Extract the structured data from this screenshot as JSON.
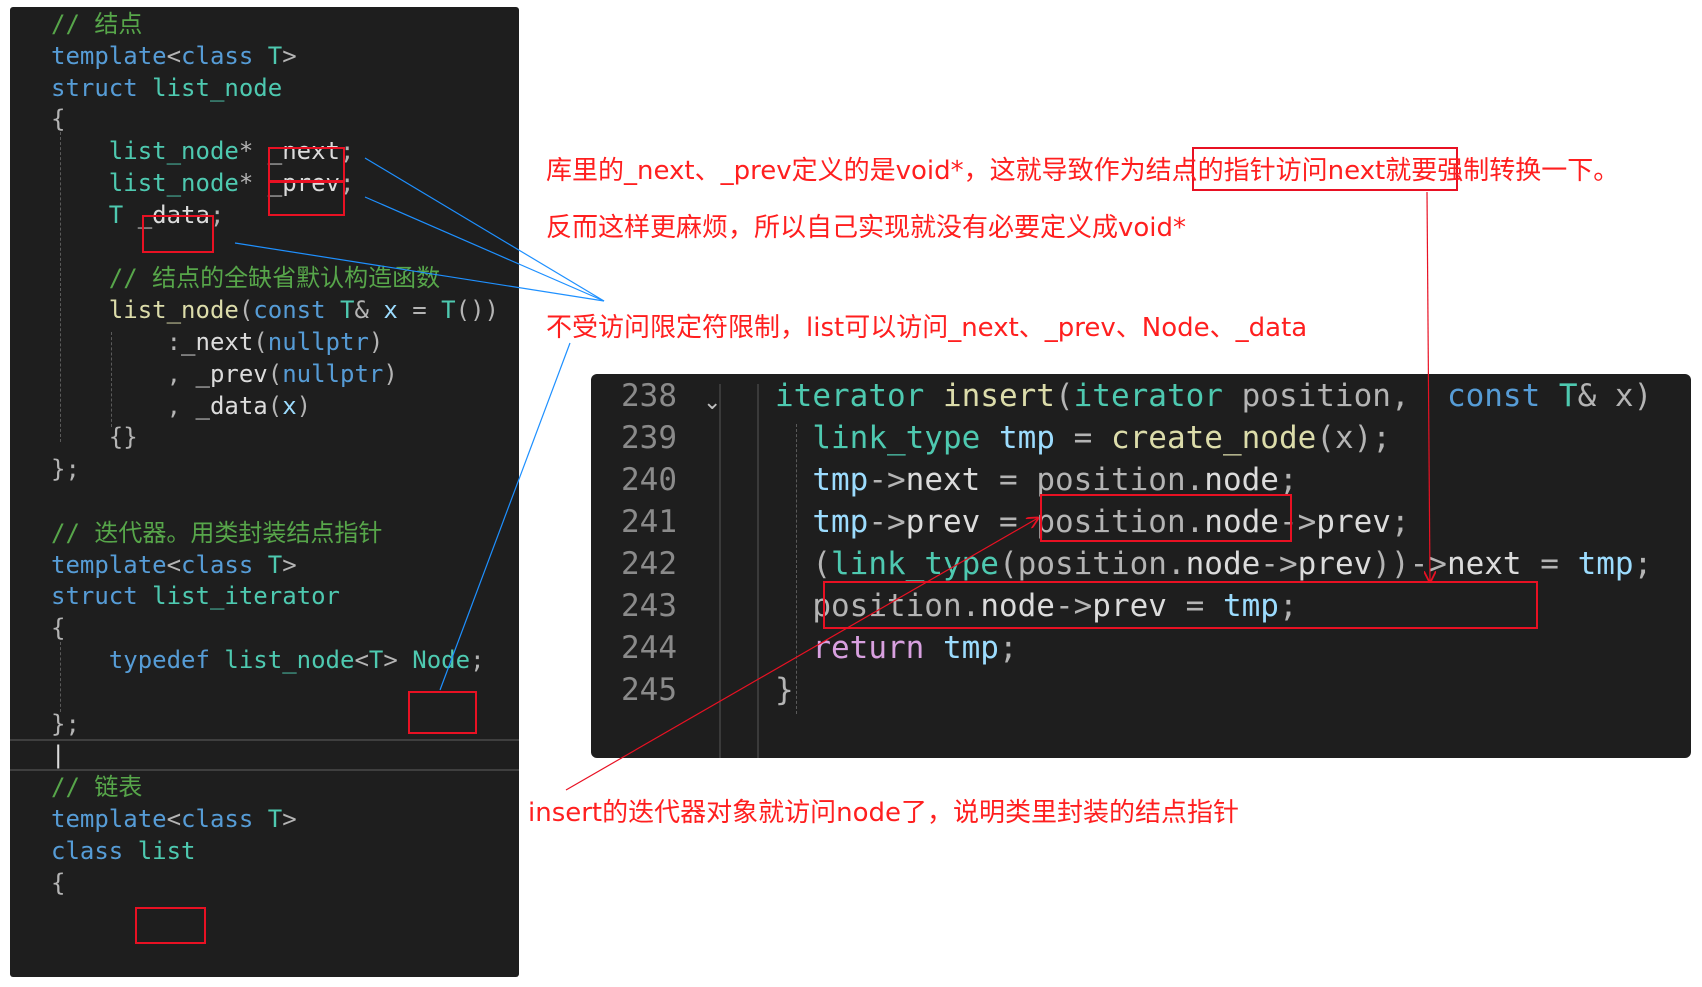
{
  "left_editor": {
    "lines": [
      [
        {
          "t": "// 结点",
          "c": "cm"
        }
      ],
      [
        {
          "t": "template",
          "c": "kw"
        },
        {
          "t": "<",
          "c": "pu"
        },
        {
          "t": "class",
          "c": "kw"
        },
        {
          "t": " T",
          "c": "ty"
        },
        {
          "t": ">",
          "c": "pu"
        }
      ],
      [
        {
          "t": "struct",
          "c": "kw"
        },
        {
          "t": " list_node",
          "c": "ty"
        }
      ],
      [
        {
          "t": "{",
          "c": "pu"
        }
      ],
      [
        {
          "t": "    list_node",
          "c": "ty"
        },
        {
          "t": "* ",
          "c": "pu"
        },
        {
          "t": "_next",
          "c": "id"
        },
        {
          "t": ";",
          "c": "pu"
        }
      ],
      [
        {
          "t": "    list_node",
          "c": "ty"
        },
        {
          "t": "* ",
          "c": "pu"
        },
        {
          "t": "_prev",
          "c": "id"
        },
        {
          "t": ";",
          "c": "pu"
        }
      ],
      [
        {
          "t": "    T",
          "c": "ty"
        },
        {
          "t": " ",
          "c": "pu"
        },
        {
          "t": "_data",
          "c": "id"
        },
        {
          "t": ";",
          "c": "pu"
        }
      ],
      [],
      [
        {
          "t": "    // 结点的全缺省默认构造函数",
          "c": "cm"
        }
      ],
      [
        {
          "t": "    list_node",
          "c": "fn"
        },
        {
          "t": "(",
          "c": "pu"
        },
        {
          "t": "const",
          "c": "kw"
        },
        {
          "t": " T",
          "c": "ty"
        },
        {
          "t": "& ",
          "c": "pu"
        },
        {
          "t": "x",
          "c": "pa"
        },
        {
          "t": " = ",
          "c": "pu"
        },
        {
          "t": "T",
          "c": "ty"
        },
        {
          "t": "())",
          "c": "pu"
        }
      ],
      [
        {
          "t": "        :",
          "c": "pu"
        },
        {
          "t": "_next",
          "c": "id"
        },
        {
          "t": "(",
          "c": "pu"
        },
        {
          "t": "nullptr",
          "c": "kw"
        },
        {
          "t": ")",
          "c": "pu"
        }
      ],
      [
        {
          "t": "        , ",
          "c": "pu"
        },
        {
          "t": "_prev",
          "c": "id"
        },
        {
          "t": "(",
          "c": "pu"
        },
        {
          "t": "nullptr",
          "c": "kw"
        },
        {
          "t": ")",
          "c": "pu"
        }
      ],
      [
        {
          "t": "        , ",
          "c": "pu"
        },
        {
          "t": "_data",
          "c": "id"
        },
        {
          "t": "(",
          "c": "pu"
        },
        {
          "t": "x",
          "c": "pa"
        },
        {
          "t": ")",
          "c": "pu"
        }
      ],
      [
        {
          "t": "    {}",
          "c": "pu"
        }
      ],
      [
        {
          "t": "};",
          "c": "pu"
        }
      ],
      [],
      [
        {
          "t": "// 迭代器。用类封装结点指针",
          "c": "cm"
        }
      ],
      [
        {
          "t": "template",
          "c": "kw"
        },
        {
          "t": "<",
          "c": "pu"
        },
        {
          "t": "class",
          "c": "kw"
        },
        {
          "t": " T",
          "c": "ty"
        },
        {
          "t": ">",
          "c": "pu"
        }
      ],
      [
        {
          "t": "struct",
          "c": "kw"
        },
        {
          "t": " list_iterator",
          "c": "ty"
        }
      ],
      [
        {
          "t": "{",
          "c": "pu"
        }
      ],
      [
        {
          "t": "    typedef",
          "c": "kw"
        },
        {
          "t": " list_node",
          "c": "ty"
        },
        {
          "t": "<",
          "c": "pu"
        },
        {
          "t": "T",
          "c": "ty"
        },
        {
          "t": "> ",
          "c": "pu"
        },
        {
          "t": "Node",
          "c": "ty"
        },
        {
          "t": ";",
          "c": "pu"
        }
      ],
      [],
      [
        {
          "t": "};",
          "c": "pu"
        }
      ],
      [
        {
          "t": "|",
          "c": "id"
        }
      ],
      [
        {
          "t": "// 链表",
          "c": "cm"
        }
      ],
      [
        {
          "t": "template",
          "c": "kw"
        },
        {
          "t": "<",
          "c": "pu"
        },
        {
          "t": "class",
          "c": "kw"
        },
        {
          "t": " T",
          "c": "ty"
        },
        {
          "t": ">",
          "c": "pu"
        }
      ],
      [
        {
          "t": "class",
          "c": "kw"
        },
        {
          "t": " list",
          "c": "ty"
        }
      ],
      [
        {
          "t": "{",
          "c": "pu"
        }
      ]
    ]
  },
  "snippet": {
    "line_numbers": [
      "238",
      "239",
      "240",
      "241",
      "242",
      "243",
      "244",
      "245"
    ],
    "fold_glyph": "⌄",
    "lines": [
      [
        {
          "t": "iterator",
          "c": "ty"
        },
        {
          "t": " insert",
          "c": "fn"
        },
        {
          "t": "(",
          "c": "pu"
        },
        {
          "t": "iterator",
          "c": "ty"
        },
        {
          "t": " position",
          "c": "pr"
        },
        {
          "t": ",  ",
          "c": "pu"
        },
        {
          "t": "const",
          "c": "kw"
        },
        {
          "t": " T",
          "c": "ty"
        },
        {
          "t": "& ",
          "c": "pu"
        },
        {
          "t": "x",
          "c": "pr"
        },
        {
          "t": ")  {",
          "c": "pu"
        }
      ],
      [
        {
          "t": "  link_type",
          "c": "ty"
        },
        {
          "t": " tmp",
          "c": "pa"
        },
        {
          "t": " = ",
          "c": "pu"
        },
        {
          "t": "create_node",
          "c": "fn"
        },
        {
          "t": "(",
          "c": "pu"
        },
        {
          "t": "x",
          "c": "pr"
        },
        {
          "t": ");",
          "c": "pu"
        }
      ],
      [
        {
          "t": "  tmp",
          "c": "pa"
        },
        {
          "t": "->",
          "c": "pu"
        },
        {
          "t": "next",
          "c": "id"
        },
        {
          "t": " = ",
          "c": "pu"
        },
        {
          "t": "position",
          "c": "pr"
        },
        {
          "t": ".",
          "c": "pu"
        },
        {
          "t": "node",
          "c": "id"
        },
        {
          "t": ";",
          "c": "pu"
        }
      ],
      [
        {
          "t": "  tmp",
          "c": "pa"
        },
        {
          "t": "->",
          "c": "pu"
        },
        {
          "t": "prev",
          "c": "id"
        },
        {
          "t": " = ",
          "c": "pu"
        },
        {
          "t": "position",
          "c": "pr"
        },
        {
          "t": ".",
          "c": "pu"
        },
        {
          "t": "node",
          "c": "id"
        },
        {
          "t": "->",
          "c": "pu"
        },
        {
          "t": "prev",
          "c": "id"
        },
        {
          "t": ";",
          "c": "pu"
        }
      ],
      [
        {
          "t": "  (",
          "c": "pu"
        },
        {
          "t": "link_type",
          "c": "ty"
        },
        {
          "t": "(",
          "c": "pu"
        },
        {
          "t": "position",
          "c": "pr"
        },
        {
          "t": ".",
          "c": "pu"
        },
        {
          "t": "node",
          "c": "id"
        },
        {
          "t": "->",
          "c": "pu"
        },
        {
          "t": "prev",
          "c": "id"
        },
        {
          "t": "))->",
          "c": "pu"
        },
        {
          "t": "next",
          "c": "id"
        },
        {
          "t": " = ",
          "c": "pu"
        },
        {
          "t": "tmp",
          "c": "pa"
        },
        {
          "t": ";",
          "c": "pu"
        }
      ],
      [
        {
          "t": "  position",
          "c": "pr"
        },
        {
          "t": ".",
          "c": "pu"
        },
        {
          "t": "node",
          "c": "id"
        },
        {
          "t": "->",
          "c": "pu"
        },
        {
          "t": "prev",
          "c": "id"
        },
        {
          "t": " = ",
          "c": "pu"
        },
        {
          "t": "tmp",
          "c": "pa"
        },
        {
          "t": ";",
          "c": "pu"
        }
      ],
      [
        {
          "t": "  return",
          "c": "ctl"
        },
        {
          "t": " tmp",
          "c": "pa"
        },
        {
          "t": ";",
          "c": "pu"
        }
      ],
      [
        {
          "t": "}",
          "c": "pu"
        }
      ]
    ]
  },
  "annotations": {
    "note1": "库里的_next、_prev定义的是void*，这就导致作为结点的指针访问next就要强制转换一下。",
    "note2": "反而这样更麻烦，所以自己实现就没有必要定义成void*",
    "note3": "不受访问限定符限制，list可以访问_next、_prev、Node、_data",
    "note4": "insert的迭代器对象就访问node了，说明类里封装的结点指针"
  },
  "colors": {
    "annotation_red": "#e81123",
    "callout_blue": "#1e90ff",
    "editor_bg": "#1e1e1e"
  }
}
